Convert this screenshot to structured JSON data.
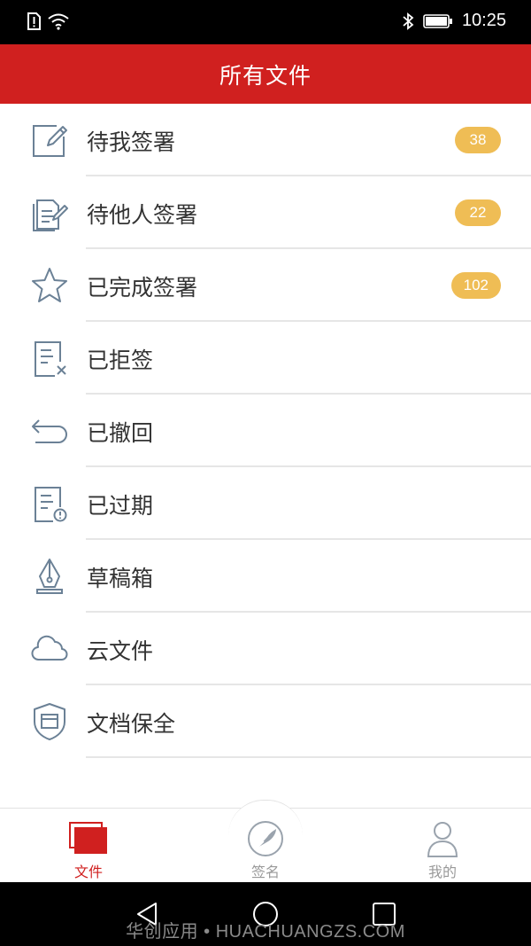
{
  "status_bar": {
    "time": "10:25",
    "icons": [
      "alert-sim-icon",
      "wifi-icon",
      "bluetooth-icon",
      "battery-icon"
    ]
  },
  "header": {
    "title": "所有文件"
  },
  "list": {
    "items": [
      {
        "label": "待我签署",
        "icon": "edit-document-icon",
        "badge": "38"
      },
      {
        "label": "待他人签署",
        "icon": "documents-sign-icon",
        "badge": "22"
      },
      {
        "label": "已完成签署",
        "icon": "star-icon",
        "badge": "102"
      },
      {
        "label": "已拒签",
        "icon": "document-reject-icon"
      },
      {
        "label": "已撤回",
        "icon": "undo-arrow-icon"
      },
      {
        "label": "已过期",
        "icon": "document-expired-icon"
      },
      {
        "label": "草稿箱",
        "icon": "pen-nib-icon"
      },
      {
        "label": "云文件",
        "icon": "cloud-icon"
      },
      {
        "label": "文档保全",
        "icon": "shield-icon"
      }
    ]
  },
  "tabs": [
    {
      "label": "文件",
      "icon": "files-icon",
      "active": true
    },
    {
      "label": "签名",
      "icon": "signature-quill-icon",
      "active": false
    },
    {
      "label": "我的",
      "icon": "user-icon",
      "active": false
    }
  ],
  "watermark": "华创应用 • HUACHUANGZS.COM",
  "colors": {
    "accent": "#d0201f",
    "badge": "#efbd55",
    "icon_stroke": "#6b8196",
    "text": "#333333",
    "tab_inactive": "#999999"
  }
}
